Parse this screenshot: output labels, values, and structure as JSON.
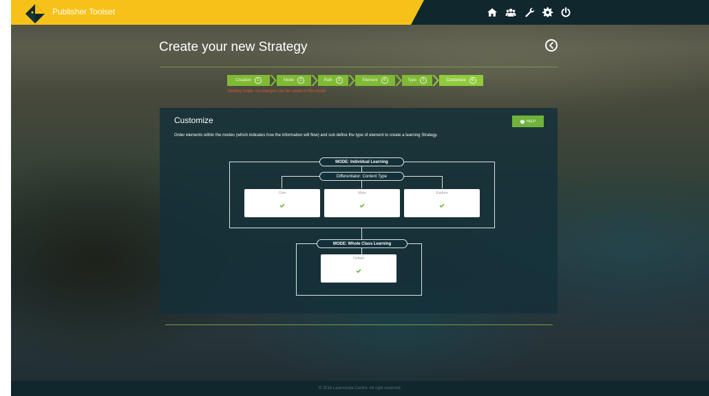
{
  "header": {
    "app_title": "Publisher Toolset",
    "nav_icons": [
      {
        "name": "home-icon"
      },
      {
        "name": "users-icon"
      },
      {
        "name": "wrench-icon"
      },
      {
        "name": "gear-icon"
      },
      {
        "name": "power-icon"
      }
    ]
  },
  "page": {
    "title": "Create your new Strategy",
    "viewing_mode_notice": "Viewing mode: no changes can be saved in this mode"
  },
  "stepper": {
    "steps": [
      {
        "label": "Creation",
        "number": "1"
      },
      {
        "label": "Mode",
        "number": "2"
      },
      {
        "label": "Path",
        "number": "3"
      },
      {
        "label": "Element",
        "number": "4"
      },
      {
        "label": "Type",
        "number": "5"
      },
      {
        "label": "Customize",
        "number": "6"
      }
    ],
    "active_step": 6
  },
  "panel": {
    "title": "Customize",
    "help_label": "HELP",
    "help_icon": "question-icon",
    "description": "Order elements within the modes (which indicates how the information will flow) and sub define the type of element to create a learning Strategy."
  },
  "diagram": {
    "mode1": {
      "label": "MODE: Individual Learning",
      "differentiator": "Differentiator: Content Type",
      "cards": [
        {
          "label": "Core"
        },
        {
          "label": "More"
        },
        {
          "label": "Explore"
        }
      ]
    },
    "mode2": {
      "label": "MODE: Whole Class Learning",
      "cards": [
        {
          "label": "Default"
        }
      ]
    }
  },
  "footer": {
    "copyright": "© 2016 Learnovate Centre. All right reserved."
  },
  "colors": {
    "header_bg": "#10272d",
    "brand_yellow": "#f6c118",
    "accent_green": "#7fba34",
    "panel_bg": "#133039",
    "warning_red": "#e2523a"
  }
}
